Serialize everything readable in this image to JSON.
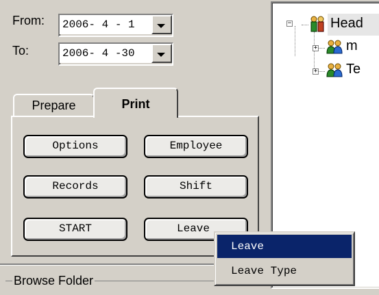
{
  "date_range": {
    "from_label": "From:",
    "from_value": "2006- 4 - 1",
    "to_label": "To:",
    "to_value": "2006- 4 -30"
  },
  "tabs": [
    {
      "label": "Prepare",
      "active": false
    },
    {
      "label": "Print",
      "active": true
    }
  ],
  "buttons": {
    "options": "Options",
    "employee": "Employee",
    "records": "Records",
    "shift": "Shift",
    "start": "START",
    "leave": "Leave"
  },
  "tree": {
    "root_label": "Head",
    "children": [
      {
        "label": "m",
        "icon": "group-icon"
      },
      {
        "label": "Te",
        "icon": "group-icon"
      }
    ]
  },
  "context_menu": {
    "items": [
      {
        "label": "Leave",
        "selected": true
      },
      {
        "label": "Leave Type",
        "selected": false
      }
    ]
  },
  "browse_folder": {
    "label": "Browse Folder"
  },
  "colors": {
    "face": "#d4d0c8",
    "highlight": "#0a246a"
  }
}
